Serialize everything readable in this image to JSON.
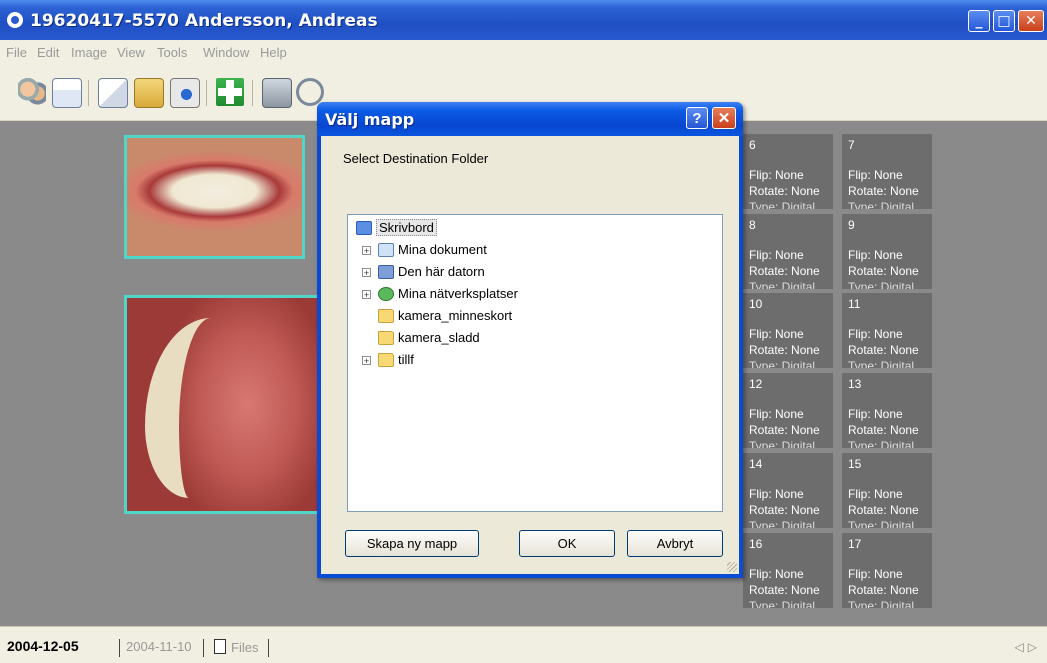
{
  "window": {
    "title": "19620417-5570 Andersson, Andreas",
    "controls": [
      "minimize",
      "maximize",
      "close"
    ]
  },
  "menu": [
    "File",
    "Edit",
    "Image",
    "View",
    "Tools",
    "Window",
    "Help"
  ],
  "toolbar": {
    "icons": [
      "patients-icon",
      "patient-card-icon",
      "import-icon",
      "export-icon",
      "camera-icon",
      "add-icon",
      "scanner-icon",
      "zoom-icon",
      "document-icon",
      "edit-icon"
    ]
  },
  "thumbnails": [
    {
      "num": "6",
      "flip": "Flip: None",
      "rotate": "Rotate: None",
      "type": "Type: Digital"
    },
    {
      "num": "7",
      "flip": "Flip: None",
      "rotate": "Rotate: None",
      "type": "Type: Digital"
    },
    {
      "num": "8",
      "flip": "Flip: None",
      "rotate": "Rotate: None",
      "type": "Type: Digital"
    },
    {
      "num": "9",
      "flip": "Flip: None",
      "rotate": "Rotate: None",
      "type": "Type: Digital"
    },
    {
      "num": "10",
      "flip": "Flip: None",
      "rotate": "Rotate: None",
      "type": "Type: Digital"
    },
    {
      "num": "11",
      "flip": "Flip: None",
      "rotate": "Rotate: None",
      "type": "Type: Digital"
    },
    {
      "num": "12",
      "flip": "Flip: None",
      "rotate": "Rotate: None",
      "type": "Type: Digital"
    },
    {
      "num": "13",
      "flip": "Flip: None",
      "rotate": "Rotate: None",
      "type": "Type: Digital"
    },
    {
      "num": "14",
      "flip": "Flip: None",
      "rotate": "Rotate: None",
      "type": "Type: Digital"
    },
    {
      "num": "15",
      "flip": "Flip: None",
      "rotate": "Rotate: None",
      "type": "Type: Digital"
    },
    {
      "num": "16",
      "flip": "Flip: None",
      "rotate": "Rotate: None",
      "type": "Type: Digital"
    },
    {
      "num": "17",
      "flip": "Flip: None",
      "rotate": "Rotate: None",
      "type": "Type: Digital"
    }
  ],
  "tabs": {
    "active": "2004-12-05",
    "second": "2004-11-10",
    "files": "Files"
  },
  "dialog": {
    "title": "Välj mapp",
    "help_label": "?",
    "close_label": "X",
    "prompt": "Select Destination Folder",
    "tree": [
      {
        "label": "Skrivbord",
        "icon": "desktop-icon",
        "expander": "",
        "selected": true
      },
      {
        "label": "Mina dokument",
        "icon": "my-documents-icon",
        "expander": "+"
      },
      {
        "label": "Den här datorn",
        "icon": "my-computer-icon",
        "expander": "+"
      },
      {
        "label": "Mina nätverksplatser",
        "icon": "network-places-icon",
        "expander": "+"
      },
      {
        "label": "kamera_minneskort",
        "icon": "folder-icon",
        "expander": ""
      },
      {
        "label": "kamera_sladd",
        "icon": "folder-icon",
        "expander": ""
      },
      {
        "label": "tillf",
        "icon": "folder-icon",
        "expander": "+"
      }
    ],
    "buttons": {
      "new_folder": "Skapa ny mapp",
      "ok": "OK",
      "cancel": "Avbryt"
    }
  },
  "colors": {
    "title_blue": "#0a4bd6",
    "workspace_gray": "#8a8a8a",
    "photo_border": "#4fd6c8",
    "thumb_gray": "#6d6d6d"
  }
}
